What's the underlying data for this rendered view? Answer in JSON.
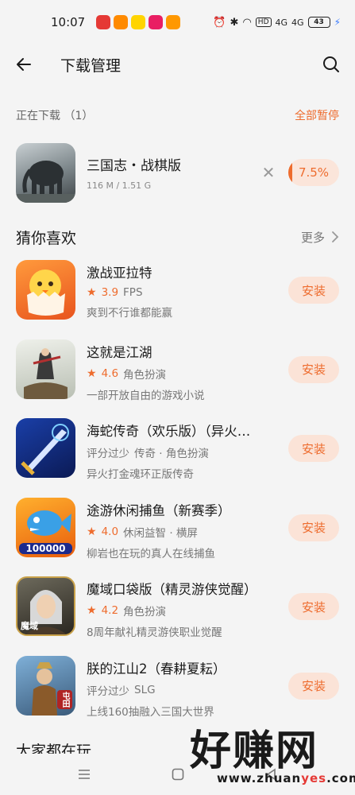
{
  "status_bar": {
    "time": "10:07",
    "signal_1": "4G",
    "signal_2": "4G",
    "hd": "HD",
    "battery": "43"
  },
  "header": {
    "title": "下载管理"
  },
  "downloading": {
    "label": "正在下载 （1）",
    "pause_all": "全部暂停",
    "item": {
      "name": "三国志・战棋版",
      "size": "116 M / 1.51 G",
      "progress_text": "7.5%",
      "progress": 0.075
    }
  },
  "recommend": {
    "title": "猜你喜欢",
    "more": "更多",
    "install_label": "安装",
    "items": [
      {
        "name": "激战亚拉特",
        "rating": "3.9",
        "tags": "FPS",
        "desc": "爽到不行谁都能赢",
        "has_rating": true
      },
      {
        "name": "这就是江湖",
        "rating": "4.6",
        "tags": "角色扮演",
        "desc": "一部开放自由的游戏小说",
        "has_rating": true
      },
      {
        "name": "海蛇传奇（欢乐版）（异火…",
        "rating": "评分过少",
        "tags": "传奇 · 角色扮演",
        "desc": "异火打金魂环正版传奇",
        "has_rating": false
      },
      {
        "name": "途游休闲捕鱼（新赛季）",
        "rating": "4.0",
        "tags": "休闲益智 · 横屏",
        "desc": "柳岩也在玩的真人在线捕鱼",
        "has_rating": true
      },
      {
        "name": "魔域口袋版（精灵游侠觉醒）",
        "rating": "4.2",
        "tags": "角色扮演",
        "desc": "8周年献礼精灵游侠职业觉醒",
        "has_rating": true
      },
      {
        "name": "朕的江山2（春耕夏耘）",
        "rating": "评分过少",
        "tags": "SLG",
        "desc": "上线160抽融入三国大世界",
        "has_rating": false
      }
    ],
    "icon_badges": [
      "",
      "",
      "",
      "100000",
      "魔域",
      "屯田"
    ]
  },
  "next_section_peek": "大家都在玩",
  "watermark": {
    "big": "好赚网",
    "small_1": "www.zhuan",
    "small_2": "yes",
    "small_3": ".com"
  },
  "colors": {
    "accent": "#ee6c2e",
    "accent_bg": "#fbe3d7",
    "background": "#f4f4f4"
  }
}
